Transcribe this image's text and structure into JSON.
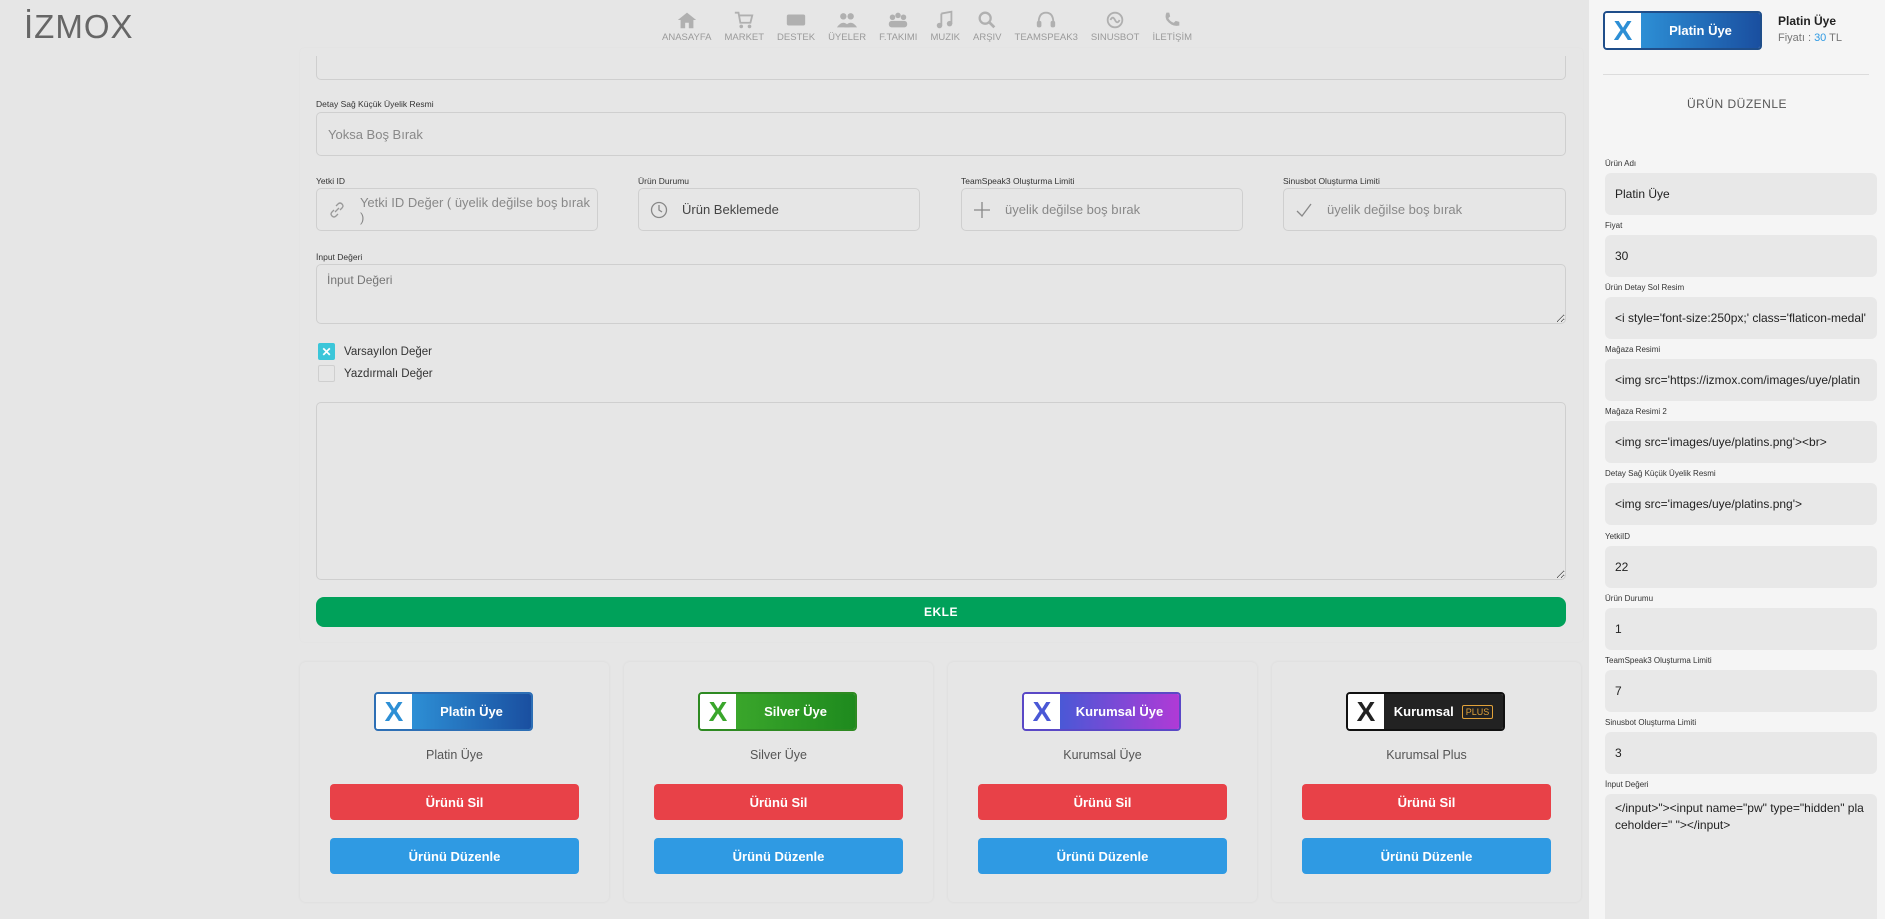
{
  "header": {
    "logo": "İZMOX",
    "nav": [
      {
        "label": "ANASAYFA",
        "icon": "home-icon"
      },
      {
        "label": "MARKET",
        "icon": "cart-icon"
      },
      {
        "label": "DESTEK",
        "icon": "ticket-icon"
      },
      {
        "label": "ÜYELER",
        "icon": "users-icon"
      },
      {
        "label": "F.TAKIMI",
        "icon": "team-icon"
      },
      {
        "label": "MUZIK",
        "icon": "music-icon"
      },
      {
        "label": "ARŞIV",
        "icon": "search-icon"
      },
      {
        "label": "TEAMSPEAK3",
        "icon": "headset-icon"
      },
      {
        "label": "SINUSBOT",
        "icon": "bot-icon"
      },
      {
        "label": "İLETİŞİM",
        "icon": "phone-icon"
      }
    ]
  },
  "form": {
    "detail_image_label": "Detay Sağ Küçük Üyelik Resmi",
    "detail_image_placeholder": "Yoksa Boş Bırak",
    "yetki_label": "Yetki ID",
    "yetki_placeholder": "Yetki ID Değer ( üyelik değilse boş bırak )",
    "durum_label": "Ürün Durumu",
    "durum_value": "Ürün Beklemede",
    "ts_label": "TeamSpeak3 Oluşturma Limiti",
    "ts_placeholder": "üyelik değilse boş bırak",
    "sinus_label": "Sinusbot Oluşturma Limiti",
    "sinus_placeholder": "üyelik değilse boş bırak",
    "input_label": "İnput Değeri",
    "input_placeholder": "İnput Değeri",
    "checkbox_default": "Varsayılon Değer",
    "checkbox_print": "Yazdırmalı Değer",
    "submit": "EKLE"
  },
  "products": [
    {
      "badge": "Platin Üye",
      "name": "Platin Üye",
      "badge_bg": "linear-gradient(90deg,#2d8fd5,#1a4fa0)",
      "x_color": "#2d8fd5"
    },
    {
      "badge": "Silver Üye",
      "name": "Silver Üye",
      "badge_bg": "linear-gradient(90deg,#3aa62b,#1e8a1e)",
      "x_color": "#3aa62b"
    },
    {
      "badge": "Kurumsal Üye",
      "name": "Kurumsal Üye",
      "badge_bg": "linear-gradient(90deg,#4a58d6,#b03ad6)",
      "x_color": "#4a58d6"
    },
    {
      "badge": "Kurumsal",
      "badge_plus": "PLUS",
      "name": "Kurumsal Plus",
      "badge_bg": "#222222",
      "x_color": "#222222"
    }
  ],
  "buttons": {
    "delete": "Ürünü Sil",
    "edit": "Ürünü Düzenle"
  },
  "panel": {
    "badge": "Platin Üye",
    "title": "Platin Üye",
    "price_label": "Fiyatı : ",
    "price_value": "30",
    "price_currency": " TL",
    "heading": "ÜRÜN DÜZENLE",
    "fields": [
      {
        "label": "Ürün Adı",
        "value": "Platin Üye"
      },
      {
        "label": "Fiyat",
        "value": "30"
      },
      {
        "label": "Ürün Detay Sol Resim",
        "value": "<i style='font-size:250px;' class='flaticon-medal'"
      },
      {
        "label": "Mağaza Resimi",
        "value": "<img src='https://izmox.com/images/uye/platin"
      },
      {
        "label": "Mağaza Resimi 2",
        "value": "<img src='images/uye/platins.png'><br>"
      },
      {
        "label": "Detay Sağ Küçük Üyelik Resmi",
        "value": "<img src='images/uye/platins.png'>"
      },
      {
        "label": "YetkiID",
        "value": "22"
      },
      {
        "label": "Ürün Durumu",
        "value": "1"
      },
      {
        "label": "TeamSpeak3 Oluşturma Limiti",
        "value": "7"
      },
      {
        "label": "Sinusbot Oluşturma Limiti",
        "value": "3"
      }
    ],
    "input_label": "İnput Değeri",
    "input_value": "</input>\"><input name=\"pw\" type=\"hidden\" placeholder=\" \"></input>"
  }
}
